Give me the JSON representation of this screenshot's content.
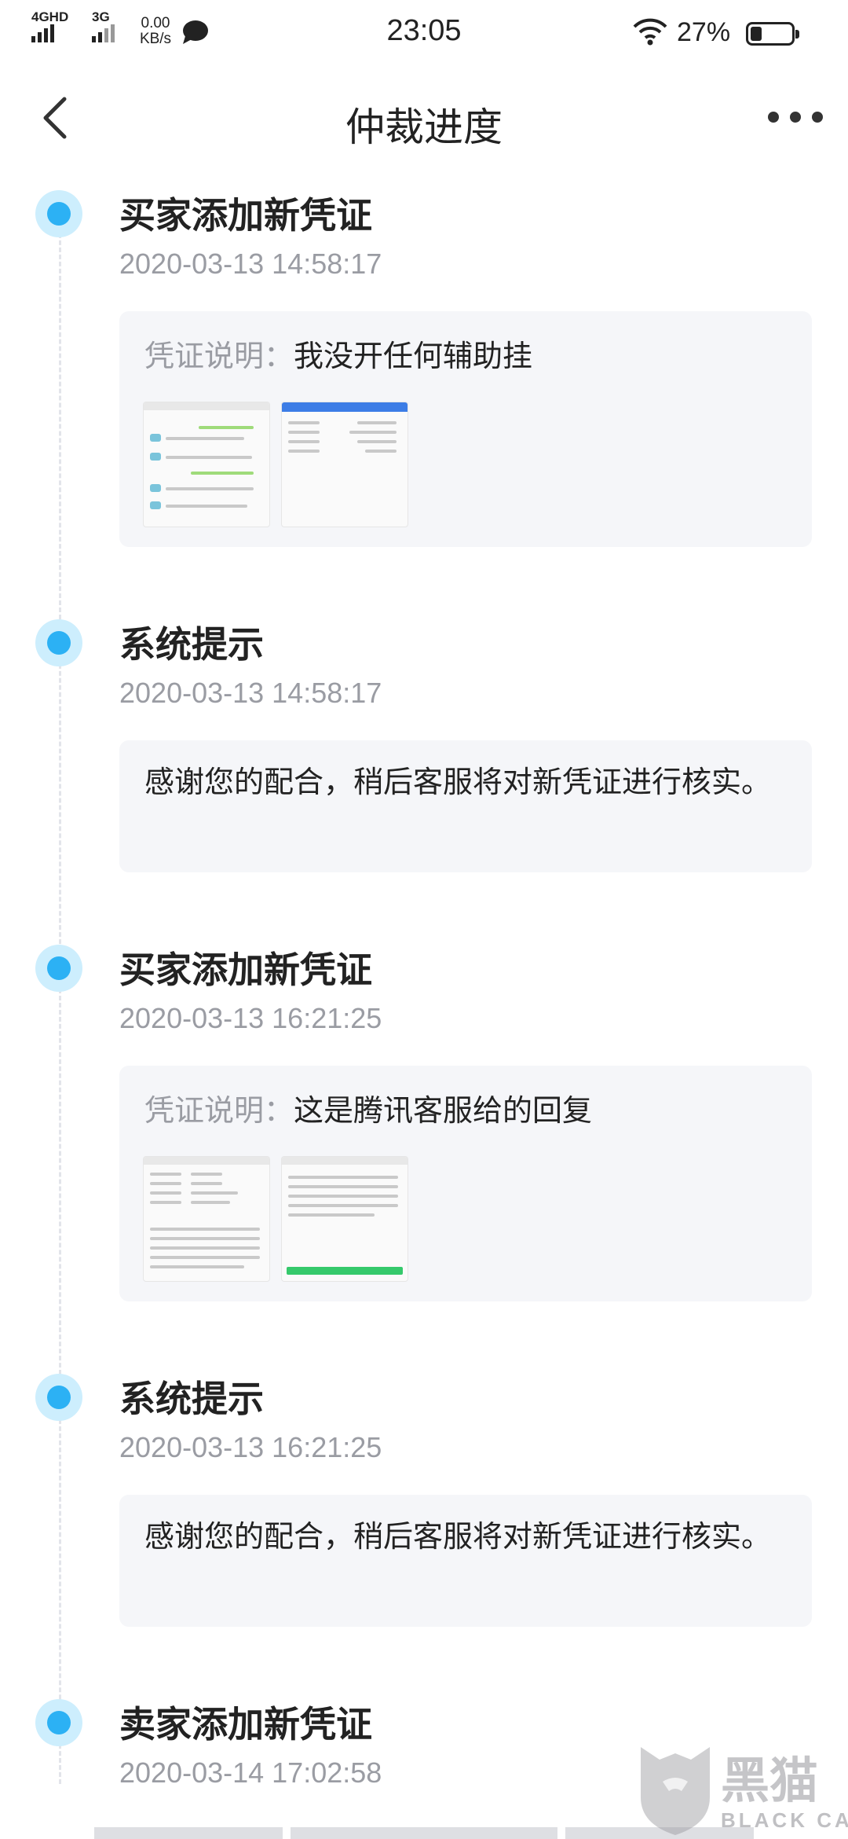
{
  "status_bar": {
    "signal_1_label": "4GHD",
    "signal_2_label": "3G",
    "net_speed_value": "0.00",
    "net_speed_unit": "KB/s",
    "time": "23:05",
    "battery_percent": "27%",
    "battery_level": 0.27,
    "icons": [
      "signal-icon",
      "chat-bubble-icon",
      "wifi-icon",
      "battery-icon"
    ]
  },
  "nav": {
    "title": "仲裁进度",
    "back_icon": "chevron-left-icon",
    "more_icon": "more-dots-icon"
  },
  "colors": {
    "timeline_dot": "#2cb1f4",
    "timeline_halo": "#cdeefd",
    "card_bg": "#f5f6f9",
    "muted_text": "#9a9ca3"
  },
  "events": [
    {
      "title": "买家添加新凭证",
      "time": "2020-03-13 14:58:17",
      "desc_label": "凭证说明：",
      "desc_value": "我没开任何辅助挂",
      "thumbnails": [
        "chat-screenshot",
        "list-screenshot"
      ]
    },
    {
      "title": "系统提示",
      "time": "2020-03-13 14:58:17",
      "message": "感谢您的配合，稍后客服将对新凭证进行核实。"
    },
    {
      "title": "买家添加新凭证",
      "time": "2020-03-13 16:21:25",
      "desc_label": "凭证说明：",
      "desc_value": "这是腾讯客服给的回复",
      "thumbnails": [
        "reply-screenshot",
        "reply-screenshot-2"
      ]
    },
    {
      "title": "系统提示",
      "time": "2020-03-13 16:21:25",
      "message": "感谢您的配合，稍后客服将对新凭证进行核实。"
    },
    {
      "title": "卖家添加新凭证",
      "time": "2020-03-14 17:02:58"
    }
  ],
  "watermark": {
    "text": "黑猫",
    "sub": "BLACK CAT"
  }
}
